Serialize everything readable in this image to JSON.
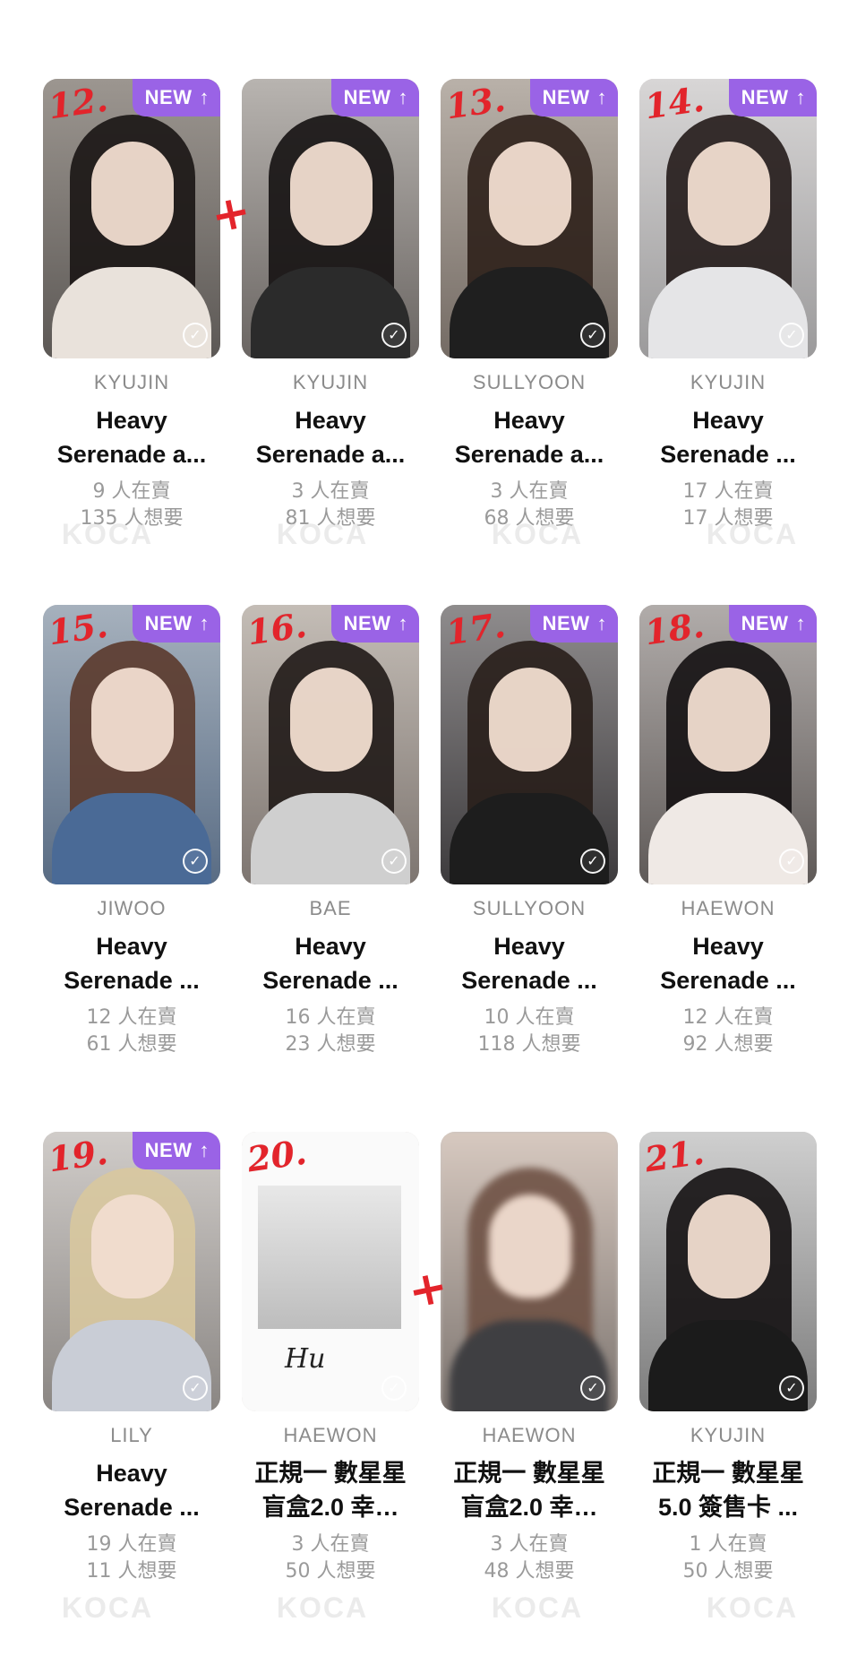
{
  "colors": {
    "new_badge": "#9a63e6",
    "annotation": "#e3242b",
    "member": "#8b8b8b",
    "stats": "#9a9a9a"
  },
  "watermark_text": "KOCA",
  "badge": {
    "label": "NEW",
    "icon": "arrow-up-icon"
  },
  "cards": [
    {
      "num": "12.",
      "new": true,
      "member": "KYUJIN",
      "title": "Heavy",
      "title2": "Serenade a...",
      "sell": "9 人在賣",
      "want": "135 人想要"
    },
    {
      "num": "",
      "new": true,
      "member": "KYUJIN",
      "title": "Heavy",
      "title2": "Serenade a...",
      "sell": "3 人在賣",
      "want": "81 人想要"
    },
    {
      "num": "13.",
      "new": true,
      "member": "SULLYOON",
      "title": "Heavy",
      "title2": "Serenade a...",
      "sell": "3 人在賣",
      "want": "68 人想要"
    },
    {
      "num": "14.",
      "new": true,
      "member": "KYUJIN",
      "title": "Heavy",
      "title2": "Serenade ...",
      "sell": "17 人在賣",
      "want": "17 人想要"
    },
    {
      "num": "15.",
      "new": true,
      "member": "JIWOO",
      "title": "Heavy",
      "title2": "Serenade ...",
      "sell": "12 人在賣",
      "want": "61 人想要"
    },
    {
      "num": "16.",
      "new": true,
      "member": "BAE",
      "title": "Heavy",
      "title2": "Serenade ...",
      "sell": "16 人在賣",
      "want": "23 人想要"
    },
    {
      "num": "17.",
      "new": true,
      "member": "SULLYOON",
      "title": "Heavy",
      "title2": "Serenade ...",
      "sell": "10 人在賣",
      "want": "118 人想要"
    },
    {
      "num": "18.",
      "new": true,
      "member": "HAEWON",
      "title": "Heavy",
      "title2": "Serenade ...",
      "sell": "12 人在賣",
      "want": "92 人想要"
    },
    {
      "num": "19.",
      "new": true,
      "member": "LILY",
      "title": "Heavy",
      "title2": "Serenade ...",
      "sell": "19 人在賣",
      "want": "11 人想要"
    },
    {
      "num": "20.",
      "new": false,
      "member": "HAEWON",
      "title": "正規一 數星星",
      "title2": "盲盒2.0 幸…",
      "sell": "3 人在賣",
      "want": "50 人想要"
    },
    {
      "num": "",
      "new": false,
      "member": "HAEWON",
      "title": "正規一 數星星",
      "title2": "盲盒2.0 幸…",
      "sell": "3 人在賣",
      "want": "48 人想要"
    },
    {
      "num": "21.",
      "new": false,
      "member": "KYUJIN",
      "title": "正規一 數星星",
      "title2": "5.0 簽售卡 ...",
      "sell": "1 人在賣",
      "want": "50 人想要"
    }
  ]
}
